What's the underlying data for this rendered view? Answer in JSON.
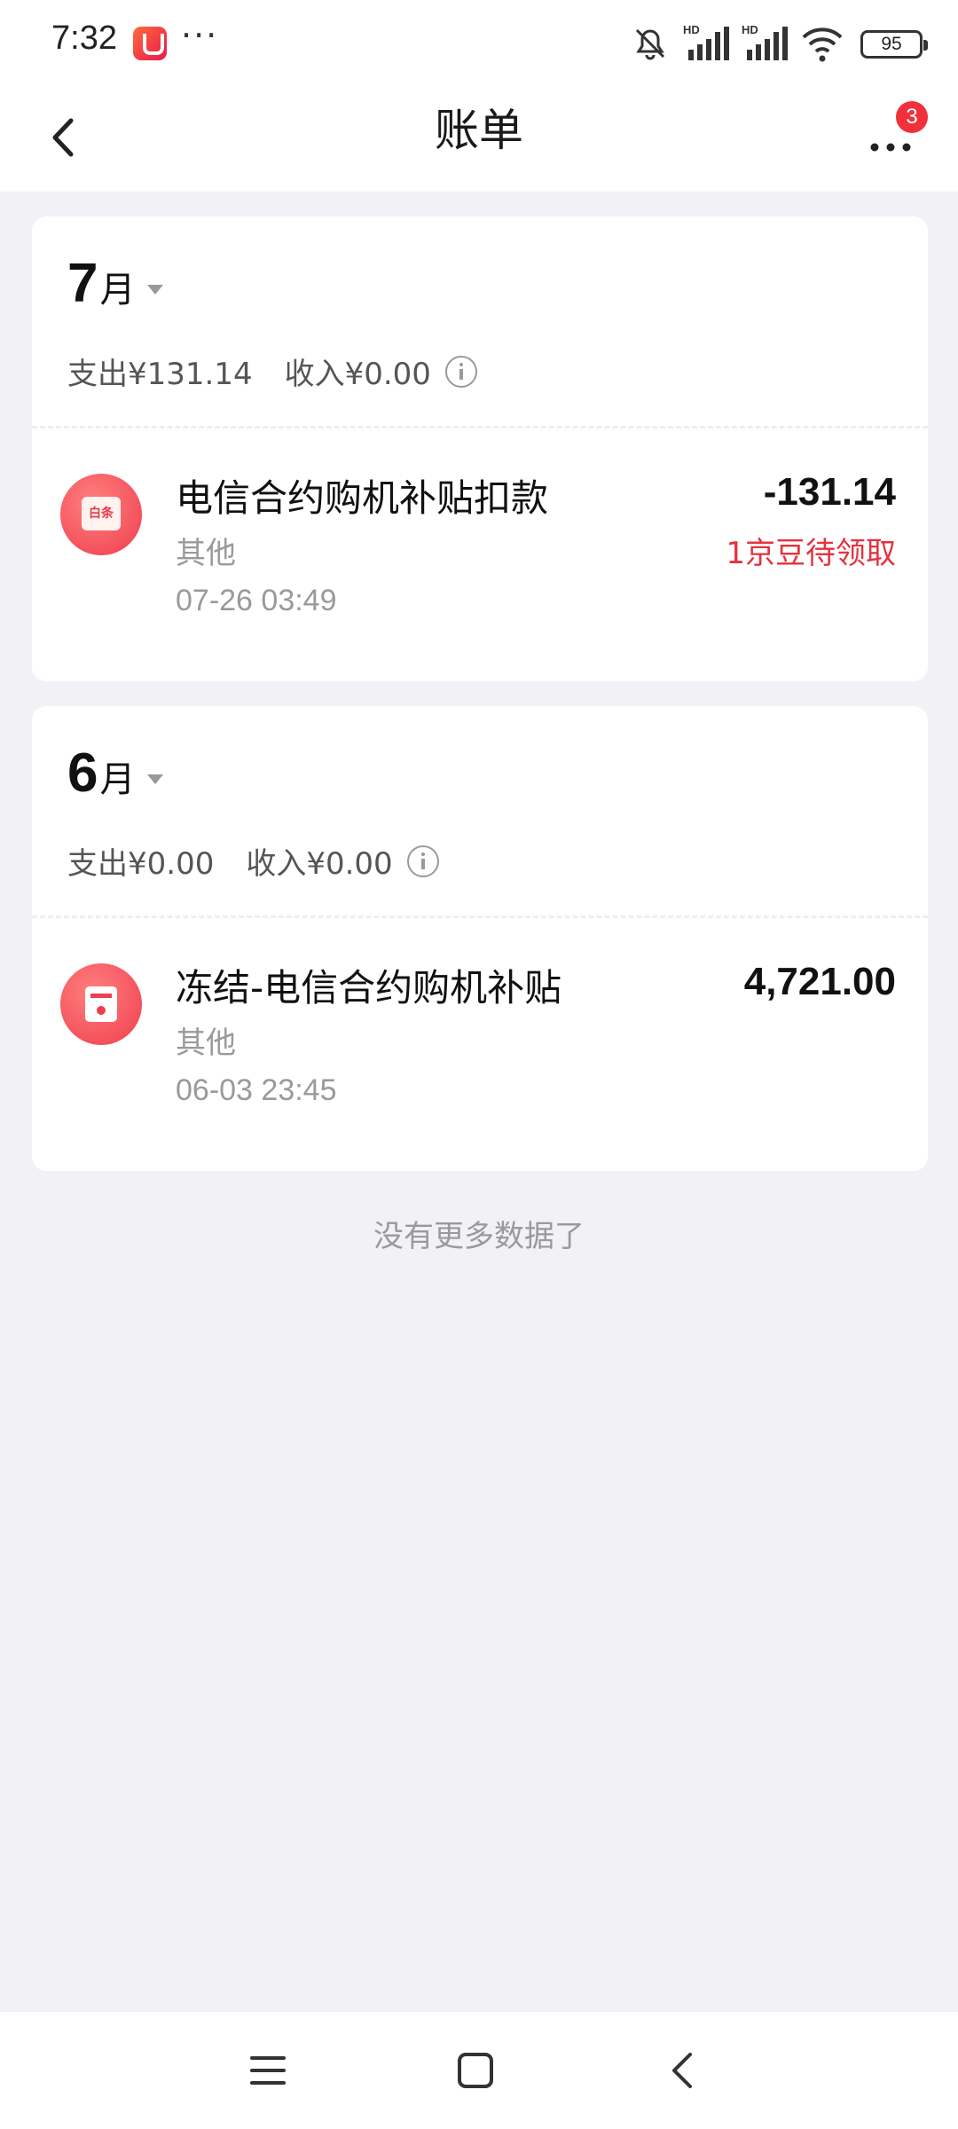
{
  "status_bar": {
    "time": "7:32",
    "more": "···",
    "battery": "95",
    "network_label": "HD"
  },
  "header": {
    "title": "账单",
    "notification_count": "3"
  },
  "months": [
    {
      "month_number": "7",
      "month_unit": "月",
      "expense": "支出¥131.14",
      "income": "收入¥0.00",
      "transactions": [
        {
          "icon": "baitiao-icon",
          "icon_text": "白条",
          "title": "电信合约购机补贴扣款",
          "category": "其他",
          "time": "07-26 03:49",
          "amount": "-131.14",
          "reward": "1京豆待领取"
        }
      ]
    },
    {
      "month_number": "6",
      "month_unit": "月",
      "expense": "支出¥0.00",
      "income": "收入¥0.00",
      "transactions": [
        {
          "icon": "frozen-icon",
          "title": "冻结-电信合约购机补贴",
          "category": "其他",
          "time": "06-03 23:45",
          "amount": "4,721.00"
        }
      ]
    }
  ],
  "footer_text": "没有更多数据了",
  "colors": {
    "accent_red": "#e2333f",
    "background": "#f1f1f6",
    "badge": "#f0313c"
  }
}
